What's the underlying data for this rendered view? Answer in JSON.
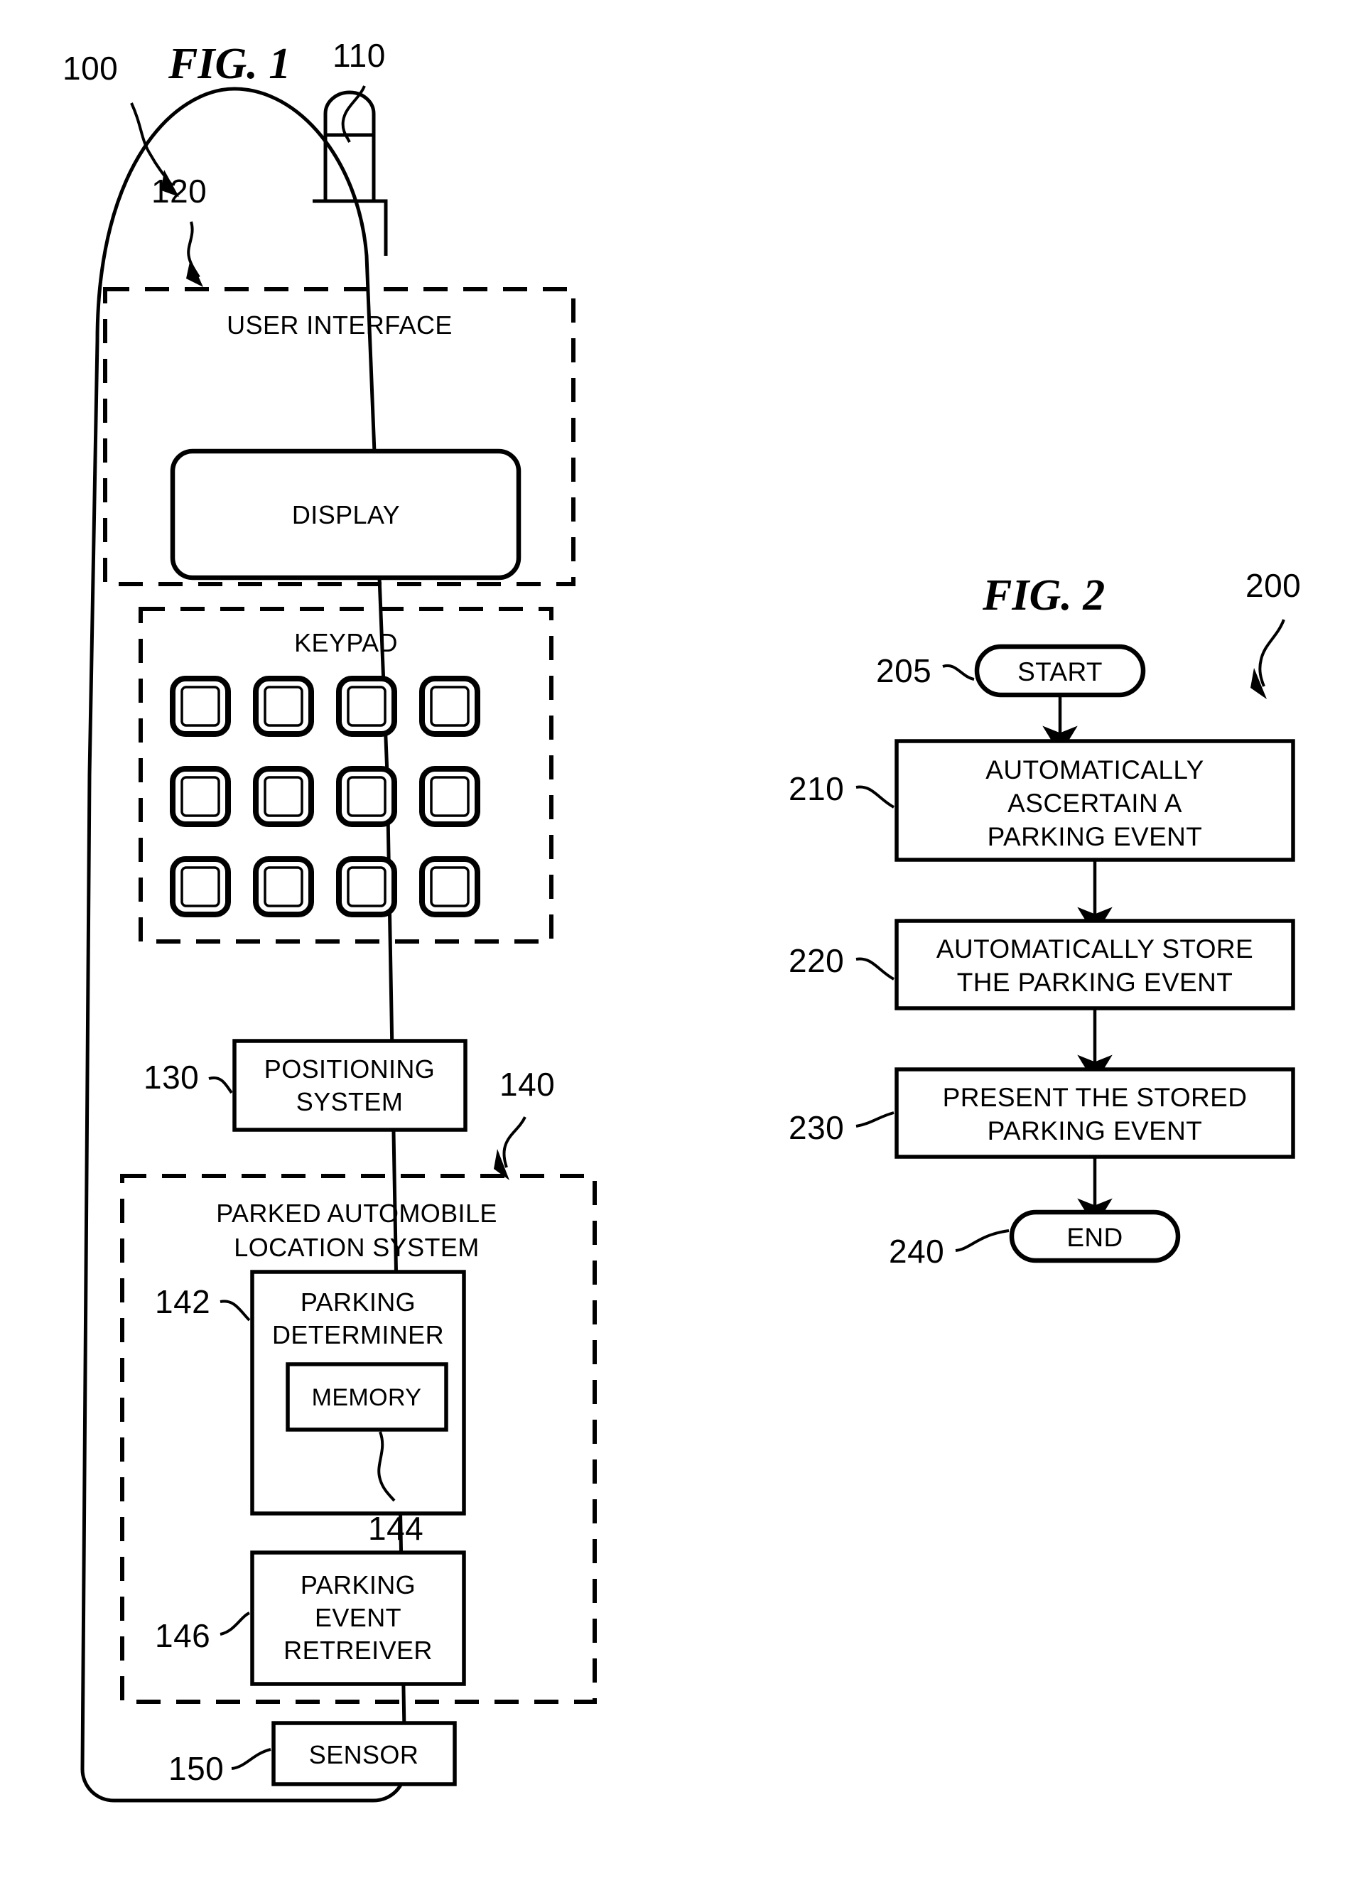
{
  "document": {
    "type": "patent-figure-sheet",
    "figures": [
      "FIG. 1",
      "FIG. 2"
    ]
  },
  "fig1": {
    "title": "FIG. 1",
    "device_ref": "100",
    "antenna_ref": "110",
    "user_interface": {
      "ref": "120",
      "label": "USER INTERFACE",
      "display": {
        "label": "DISPLAY"
      },
      "keypad": {
        "label": "KEYPAD",
        "rows": 3,
        "cols": 4,
        "key_count": 12
      }
    },
    "positioning_system": {
      "ref": "130",
      "label_line1": "POSITIONING",
      "label_line2": "SYSTEM"
    },
    "parked_automobile_location_system": {
      "ref": "140",
      "label_line1": "PARKED AUTOMOBILE",
      "label_line2": "LOCATION SYSTEM",
      "parking_determiner": {
        "ref": "142",
        "label_line1": "PARKING",
        "label_line2": "DETERMINER",
        "memory": {
          "ref": "144",
          "label": "MEMORY"
        }
      },
      "parking_event_retreiver": {
        "ref": "146",
        "label_line1": "PARKING",
        "label_line2": "EVENT",
        "label_line3": "RETREIVER"
      }
    },
    "sensor": {
      "ref": "150",
      "label": "SENSOR"
    }
  },
  "fig2": {
    "title": "FIG. 2",
    "method_ref": "200",
    "nodes": [
      {
        "ref": "205",
        "shape": "terminator",
        "lines": [
          "START"
        ]
      },
      {
        "ref": "210",
        "shape": "process",
        "lines": [
          "AUTOMATICALLY",
          "ASCERTAIN A",
          "PARKING EVENT"
        ]
      },
      {
        "ref": "220",
        "shape": "process",
        "lines": [
          "AUTOMATICALLY STORE",
          "THE PARKING EVENT"
        ]
      },
      {
        "ref": "230",
        "shape": "process",
        "lines": [
          "PRESENT THE STORED",
          "PARKING EVENT"
        ]
      },
      {
        "ref": "240",
        "shape": "terminator",
        "lines": [
          "END"
        ]
      }
    ]
  },
  "colors": {
    "ink": "#000000",
    "paper": "#ffffff"
  }
}
